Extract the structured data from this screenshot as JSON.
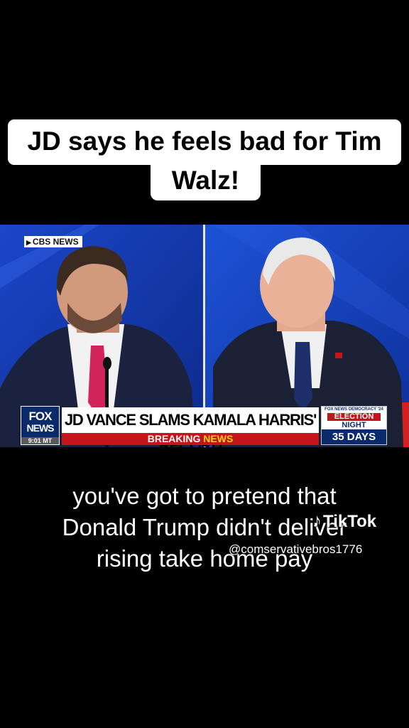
{
  "caption": {
    "line1": "JD says he feels bad for Tim",
    "line2": "Walz!"
  },
  "video": {
    "source_tag": "CBS NEWS",
    "network_logo": {
      "line1": "FOX",
      "line2": "NEWS",
      "time": "9:01 MT"
    },
    "chyron": {
      "headline": "JD VANCE SLAMS KAMALA HARRIS' RECORD",
      "banner_word1": "BREAKING",
      "banner_word2": "NEWS"
    },
    "election_box": {
      "small_text": "FOX NEWS DEMOCRACY '24",
      "line1": "ELECTION",
      "line2": "NIGHT",
      "countdown": "35 DAYS"
    }
  },
  "subtitle": {
    "line1": "you've got to pretend that",
    "line2": "Donald Trump didn't deliver",
    "line3": "rising take home pay"
  },
  "watermark": {
    "brand": "TikTok",
    "handle": "@comservativebros1776"
  },
  "colors": {
    "background": "#000000",
    "studio_blue": "#1436a8",
    "chyron_red": "#c3151b",
    "fox_navy": "#0b2a6b"
  }
}
